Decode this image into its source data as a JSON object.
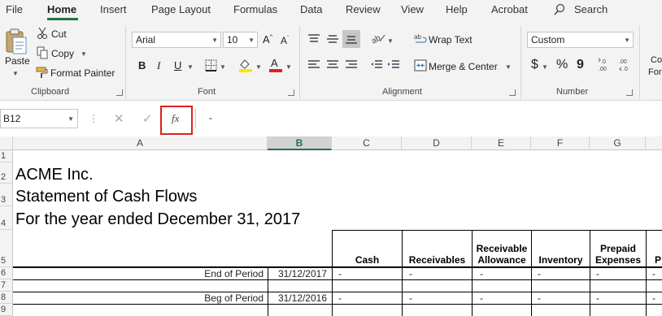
{
  "menu": {
    "items": [
      "File",
      "Home",
      "Insert",
      "Page Layout",
      "Formulas",
      "Data",
      "Review",
      "View",
      "Help",
      "Acrobat"
    ],
    "search": "Search"
  },
  "clipboard": {
    "paste": "Paste",
    "cut": "Cut",
    "copy": "Copy",
    "format_painter": "Format Painter",
    "label": "Clipboard"
  },
  "font": {
    "name": "Arial",
    "size": "10",
    "label": "Font",
    "bold": "B",
    "italic": "I",
    "underline": "U",
    "grow": "A",
    "shrink": "A"
  },
  "alignment": {
    "wrap_text": "Wrap Text",
    "merge_center": "Merge & Center",
    "label": "Alignment"
  },
  "number": {
    "format": "Custom",
    "currency": "$",
    "percent": "%",
    "comma": "9",
    "label": "Number"
  },
  "styles": {
    "conditional": "Co",
    "format": "For"
  },
  "formula_bar": {
    "name_box": "B12",
    "fx": "fx",
    "value": "-"
  },
  "grid": {
    "columns": [
      "A",
      "B",
      "C",
      "D",
      "E",
      "F",
      "G"
    ],
    "rows": [
      "1",
      "2",
      "3",
      "4",
      "5",
      "6",
      "7",
      "8",
      "9"
    ],
    "titles": [
      "ACME Inc.",
      "Statement of Cash Flows",
      "For the year ended December 31, 2017"
    ],
    "headers": [
      "Cash",
      "Receivables",
      "Receivable Allowance",
      "Inventory",
      "Prepaid Expenses",
      "P"
    ],
    "row6": {
      "label": "End of Period",
      "date": "31/12/2017",
      "values": [
        "-",
        "-",
        "-",
        "-",
        "-",
        "-"
      ]
    },
    "row8": {
      "label": "Beg of Period",
      "date": "31/12/2016",
      "values": [
        "-",
        "-",
        "-",
        "-",
        "-",
        "-"
      ]
    }
  },
  "colors": {
    "accent": "#217346",
    "highlight_box": "#e02020",
    "font_color": "#e02020",
    "highlight_color": "#ffe600"
  }
}
